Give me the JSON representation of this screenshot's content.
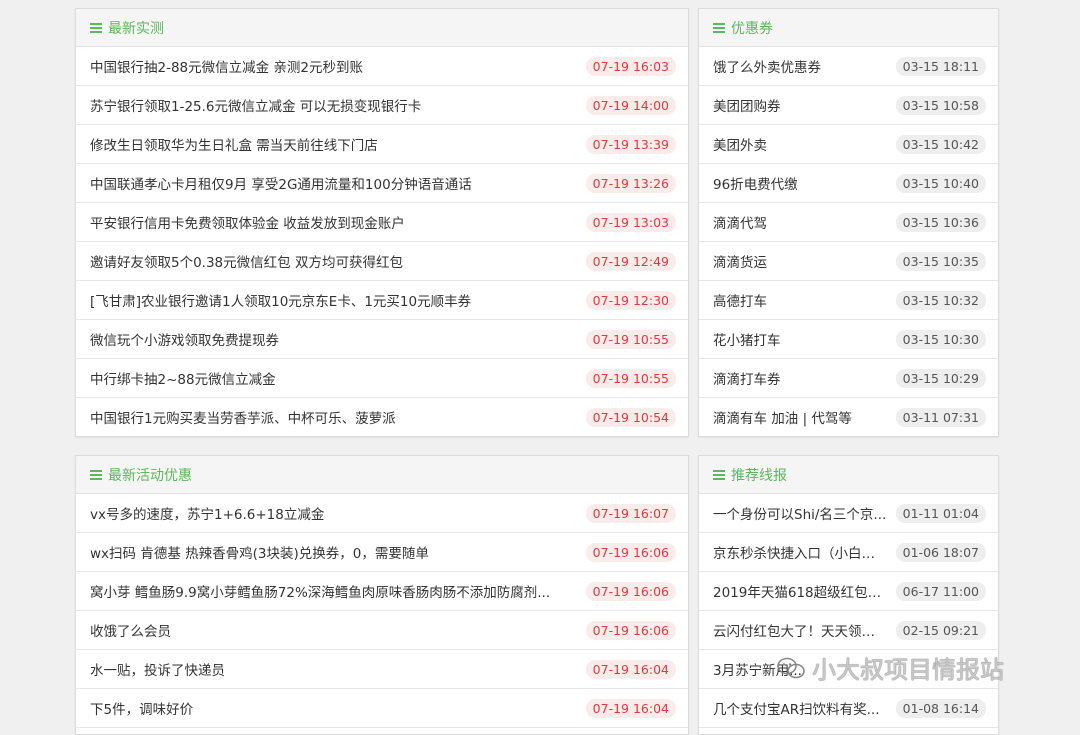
{
  "panels": {
    "latest_tests": {
      "title": "最新实测",
      "items": [
        {
          "title": "中国银行抽2-88元微信立减金 亲测2元秒到账",
          "time": "07-19 16:03"
        },
        {
          "title": "苏宁银行领取1-25.6元微信立减金 可以无损变现银行卡",
          "time": "07-19 14:00"
        },
        {
          "title": "修改生日领取华为生日礼盒 需当天前往线下门店",
          "time": "07-19 13:39"
        },
        {
          "title": "中国联通孝心卡月租仅9月 享受2G通用流量和100分钟语音通话",
          "time": "07-19 13:26"
        },
        {
          "title": "平安银行信用卡免费领取体验金 收益发放到现金账户",
          "time": "07-19 13:03"
        },
        {
          "title": "邀请好友领取5个0.38元微信红包 双方均可获得红包",
          "time": "07-19 12:49"
        },
        {
          "title": "[飞甘肃]农业银行邀请1人领取10元京东E卡、1元买10元顺丰券",
          "time": "07-19 12:30"
        },
        {
          "title": "微信玩个小游戏领取免费提现券",
          "time": "07-19 10:55"
        },
        {
          "title": "中行绑卡抽2~88元微信立减金",
          "time": "07-19 10:55"
        },
        {
          "title": "中国银行1元购买麦当劳香芋派、中杯可乐、菠萝派",
          "time": "07-19 10:54"
        }
      ]
    },
    "coupons": {
      "title": "优惠券",
      "items": [
        {
          "title": "饿了么外卖优惠券",
          "time": "03-15 18:11"
        },
        {
          "title": "美团团购券",
          "time": "03-15 10:58"
        },
        {
          "title": "美团外卖",
          "time": "03-15 10:42"
        },
        {
          "title": "96折电费代缴",
          "time": "03-15 10:40"
        },
        {
          "title": "滴滴代驾",
          "time": "03-15 10:36"
        },
        {
          "title": "滴滴货运",
          "time": "03-15 10:35"
        },
        {
          "title": "高德打车",
          "time": "03-15 10:32"
        },
        {
          "title": "花小猪打车",
          "time": "03-15 10:30"
        },
        {
          "title": "滴滴打车券",
          "time": "03-15 10:29"
        },
        {
          "title": "滴滴有车 加油 | 代驾等",
          "time": "03-11 07:31"
        }
      ]
    },
    "latest_deals": {
      "title": "最新活动优惠",
      "items": [
        {
          "title": "vx号多的速度，苏宁1+6.6+18立减金",
          "time": "07-19 16:07"
        },
        {
          "title": "wx扫码 肯德基 热辣香骨鸡(3块装)兑换券，0，需要随单",
          "time": "07-19 16:06"
        },
        {
          "title": "窝小芽 鳕鱼肠9.9窝小芽鳕鱼肠72%深海鳕鱼肉原味香肠肉肠不添加防腐剂...",
          "time": "07-19 16:06"
        },
        {
          "title": "收饿了么会员",
          "time": "07-19 16:06"
        },
        {
          "title": "水一贴，投诉了快递员",
          "time": "07-19 16:04"
        },
        {
          "title": "下5件，调味好价",
          "time": "07-19 16:04"
        }
      ]
    },
    "recommended": {
      "title": "推荐线报",
      "items": [
        {
          "title": "一个身份可以Shi/名三个京...",
          "time": "01-11 01:04"
        },
        {
          "title": "京东秒杀快捷入口（小白教...",
          "time": "01-06 18:07"
        },
        {
          "title": "2019年天猫618超级红包最...",
          "time": "06-17 11:00"
        },
        {
          "title": "云闪付红包大了！天天领、...",
          "time": "02-15 09:21"
        },
        {
          "title": "3月苏宁新用...",
          "time": ""
        },
        {
          "title": "几个支付宝AR扫饮料有奖...",
          "time": "01-08 16:14"
        }
      ]
    }
  },
  "watermark": {
    "text": "小大叔项目情报站"
  },
  "colors": {
    "accent": "#5cb85c",
    "time_red": "#e4393c"
  }
}
